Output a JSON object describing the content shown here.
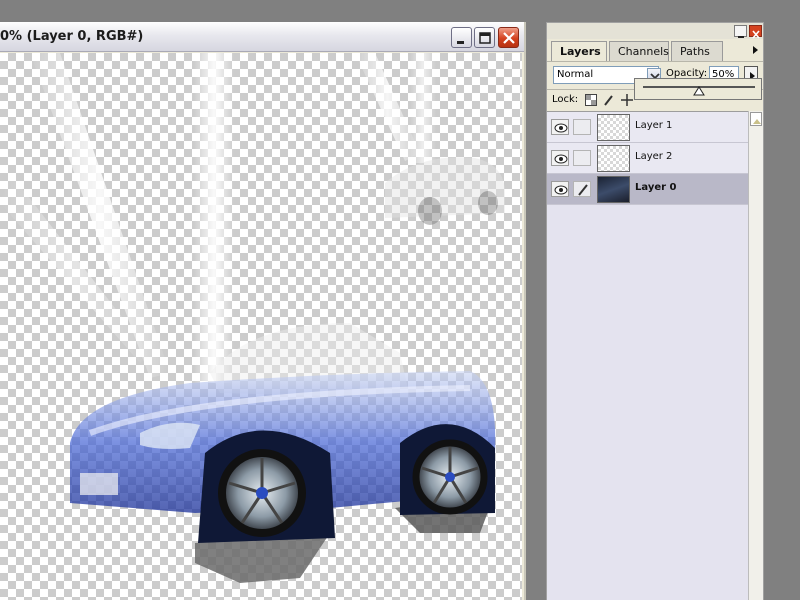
{
  "document": {
    "title": "0% (Layer 0, RGB#)"
  },
  "palette": {
    "tabs": [
      {
        "label": "Layers",
        "active": true
      },
      {
        "label": "Channels",
        "active": false
      },
      {
        "label": "Paths",
        "active": false
      }
    ],
    "blend_mode": "Normal",
    "opacity_label": "Opacity:",
    "opacity_value": "50%",
    "lock_label": "Lock:",
    "layers": [
      {
        "name": "Layer 1",
        "visible": true,
        "selected": false
      },
      {
        "name": "Layer 2",
        "visible": true,
        "selected": false
      },
      {
        "name": "Layer 0",
        "visible": true,
        "selected": true
      }
    ]
  },
  "colors": {
    "accent": "#2a4cc0",
    "selected_layer": "#b9b8c8",
    "close_button": "#d4421f"
  },
  "icons": [
    "minimize-icon",
    "maximize-icon",
    "close-icon",
    "eye-icon",
    "brush-icon",
    "chevron-down-icon",
    "arrow-right-icon",
    "lock-transparency-icon",
    "lock-move-icon"
  ]
}
